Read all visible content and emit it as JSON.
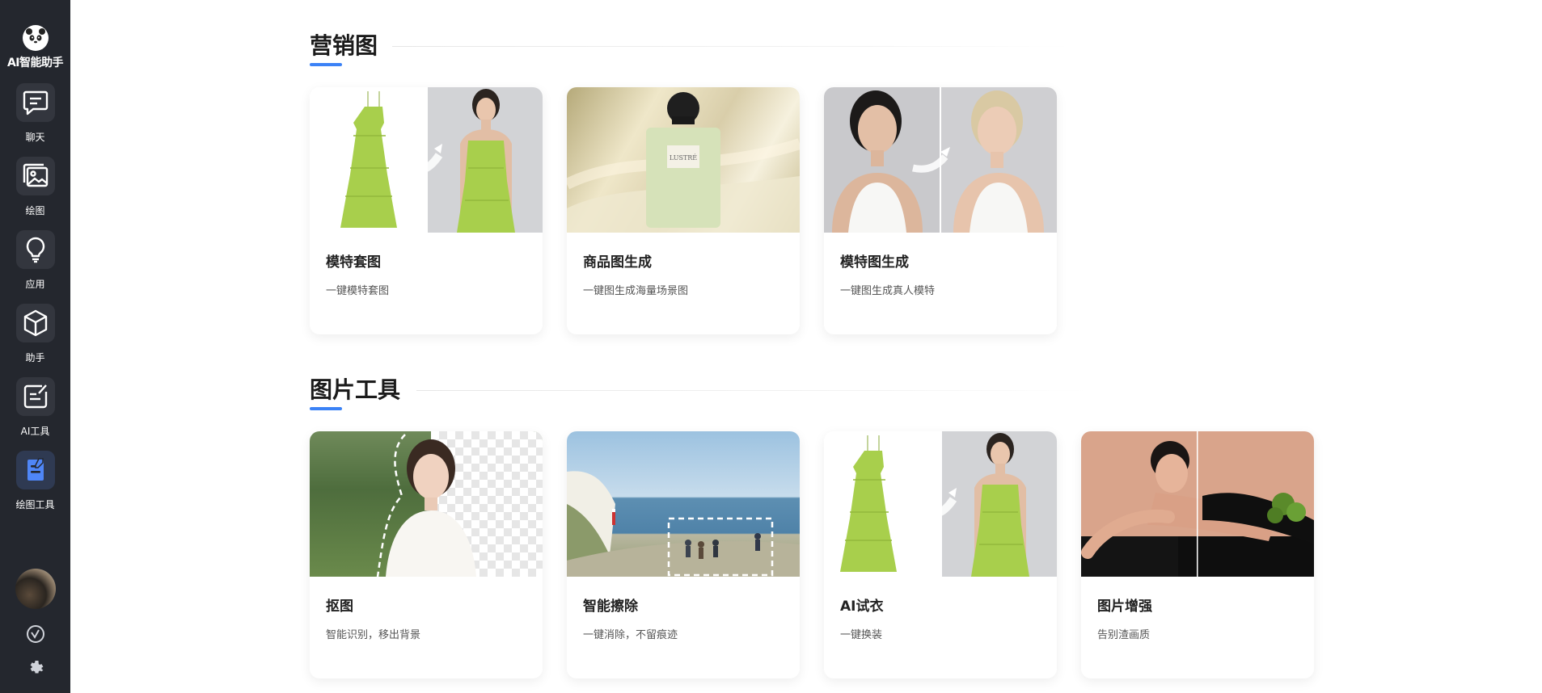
{
  "brand": {
    "name": "AI智能助手",
    "logo_icon": "panda-logo-icon"
  },
  "sidebar": {
    "items": [
      {
        "label": "聊天",
        "icon": "chat-icon"
      },
      {
        "label": "绘图",
        "icon": "image-icon"
      },
      {
        "label": "应用",
        "icon": "lightbulb-icon"
      },
      {
        "label": "助手",
        "icon": "cube-icon"
      },
      {
        "label": "AI工具",
        "icon": "edit-note-icon"
      },
      {
        "label": "绘图工具",
        "icon": "drawing-tool-icon",
        "active": true
      }
    ],
    "bottom": [
      {
        "icon": "avatar"
      },
      {
        "icon": "version-check-icon"
      },
      {
        "icon": "gear-icon"
      }
    ]
  },
  "sections": [
    {
      "title": "营销图",
      "cards": [
        {
          "title": "模特套图",
          "desc": "一键模特套图",
          "image": "dress-to-model"
        },
        {
          "title": "商品图生成",
          "desc": "一键图生成海量场景图",
          "image": "perfume-bottle",
          "bottle_label": "LUSTRÉ"
        },
        {
          "title": "模特图生成",
          "desc": "一键图生成真人模特",
          "image": "face-swap"
        }
      ]
    },
    {
      "title": "图片工具",
      "cards": [
        {
          "title": "抠图",
          "desc": "智能识别，移出背景",
          "image": "cutout-transparent"
        },
        {
          "title": "智能擦除",
          "desc": "一键消除，不留痕迹",
          "image": "seaside-erase"
        },
        {
          "title": "AI试衣",
          "desc": "一键换装",
          "image": "dress-to-model"
        },
        {
          "title": "图片增强",
          "desc": "告别渣画质",
          "image": "enhance-split"
        }
      ]
    }
  ],
  "colors": {
    "sidebar_bg": "#24272e",
    "accent": "#3b82f6",
    "dress_green": "#a8cf4c"
  }
}
